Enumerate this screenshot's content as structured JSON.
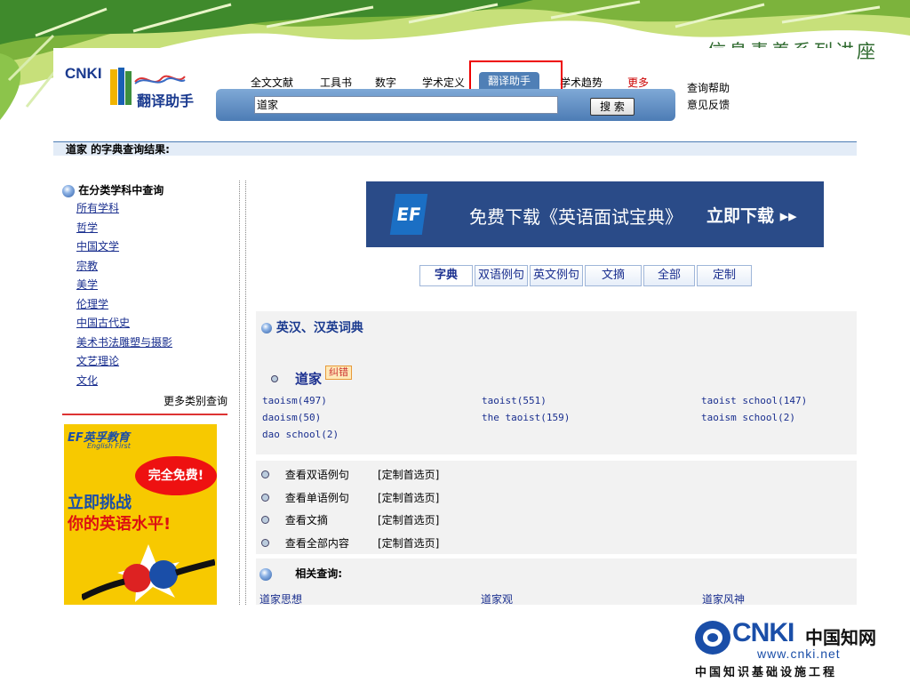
{
  "banner": {
    "slogan": "信息素养系列讲座"
  },
  "logo": {
    "brand": "CNKI",
    "product": "翻译助手"
  },
  "nav": {
    "tabs": [
      "全文文献",
      "工具书",
      "数字",
      "学术定义",
      "翻译助手",
      "学术趋势",
      "更多"
    ],
    "active_index": 4
  },
  "search": {
    "query": "道家",
    "button_label": "搜 索"
  },
  "help": {
    "query_help": "查询帮助",
    "feedback": "意见反馈"
  },
  "result_title": "道家 的字典查询结果:",
  "category": {
    "heading": "在分类学科中查询",
    "items": [
      "所有学科",
      "哲学",
      "中国文学",
      "宗教",
      "美学",
      "伦理学",
      "中国古代史",
      "美术书法雕塑与摄影",
      "文艺理论",
      "文化"
    ],
    "more": "更多类别查询"
  },
  "ad_left": {
    "brand": "EF英孚教育",
    "brand_en": "English First",
    "free": "完全免费!",
    "line1": "立即挑战",
    "line2": "你的英语水平!"
  },
  "ad_top": {
    "logo": "EF",
    "message": "免费下载《英语面试宝典》",
    "cta": "立即下载 ▸▸"
  },
  "result_tabs": [
    "字典",
    "双语例句",
    "英文例句",
    "文摘",
    "全部",
    "定制"
  ],
  "dict": {
    "heading": "英汉、汉英词典",
    "term": "道家",
    "correct_label": "纠错",
    "translations": [
      "taoism(497)",
      "taoist(551)",
      "taoist school(147)",
      "daoism(50)",
      "the taoist(159)",
      "taoism school(2)",
      "dao school(2)"
    ]
  },
  "links": {
    "rows": [
      {
        "label": "查看双语例句",
        "custom": "[定制首选页]"
      },
      {
        "label": "查看单语例句",
        "custom": "[定制首选页]"
      },
      {
        "label": "查看文摘",
        "custom": "[定制首选页]"
      },
      {
        "label": "查看全部内容",
        "custom": "[定制首选页]"
      }
    ]
  },
  "related": {
    "heading": "相关查询:",
    "items": [
      "道家思想",
      "道家观",
      "道家风神"
    ]
  },
  "footer_logo": {
    "brand": "CNKI",
    "cn": "中国知网",
    "url": "www.cnki.net",
    "project": "中国知识基础设施工程"
  }
}
